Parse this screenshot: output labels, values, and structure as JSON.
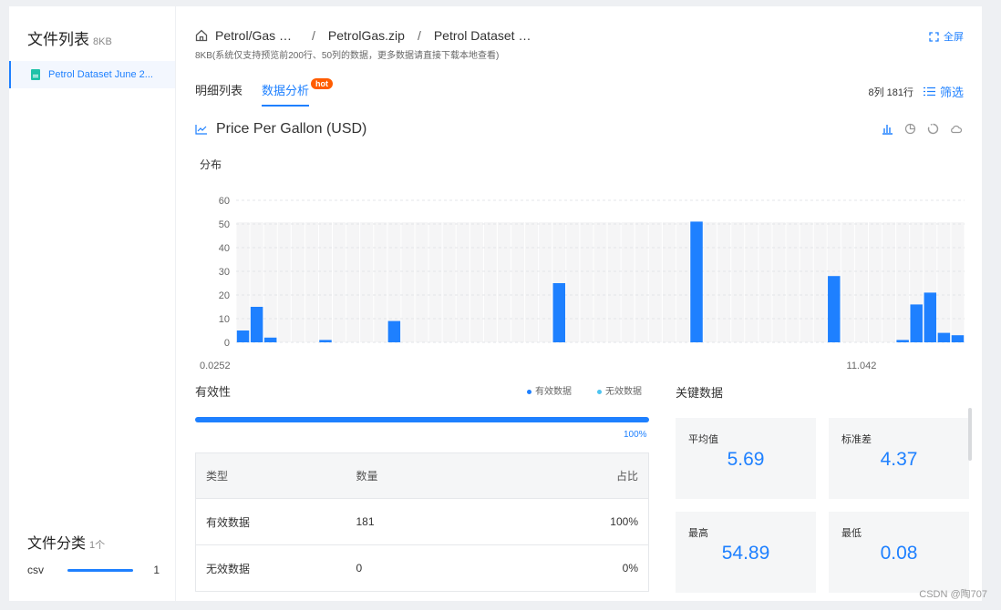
{
  "sidebar": {
    "title": "文件列表",
    "title_size": "8KB",
    "files": [
      {
        "name": "Petrol Dataset June 2..."
      }
    ],
    "category_title": "文件分类",
    "category_count": "1个",
    "categories": [
      {
        "label": "csv",
        "count": "1"
      }
    ]
  },
  "header": {
    "breadcrumb": [
      "Petrol/Gas 全球油价...",
      "PetrolGas.zip",
      "Petrol Dataset June 2..."
    ],
    "separator": "/",
    "note": "8KB(系统仅支持预览前200行、50列的数据，更多数据请直接下载本地查看)",
    "fullscreen_label": "全屏"
  },
  "tabs": [
    {
      "label": "明细列表",
      "active": false
    },
    {
      "label": "数据分析",
      "active": true,
      "badge": "hot"
    }
  ],
  "meta": {
    "dims": "8列 181行",
    "filter_label": "筛选"
  },
  "field": {
    "title": "Price Per Gallon (USD)",
    "distribution_label": "分布"
  },
  "chart_data": {
    "type": "bar",
    "bins": 50,
    "values": [
      5,
      15,
      2,
      0,
      0,
      0,
      1,
      0,
      0,
      0,
      0,
      9,
      0,
      0,
      0,
      0,
      0,
      0,
      0,
      0,
      0,
      0,
      0,
      25,
      0,
      0,
      0,
      0,
      0,
      0,
      0,
      0,
      0,
      51,
      0,
      0,
      0,
      0,
      0,
      0,
      0,
      0,
      0,
      28,
      0,
      0,
      0,
      0,
      1,
      16,
      21,
      4,
      3
    ],
    "ylim": [
      0,
      60
    ],
    "y_ticks": [
      0,
      10,
      20,
      30,
      40,
      50,
      60
    ],
    "x_labels": [
      {
        "text": "0.0252",
        "at_bin": 0
      },
      {
        "text": "11.042",
        "at_bin": 45
      }
    ],
    "bar_color": "#1e80ff",
    "grid": "horizontal dashed"
  },
  "validity": {
    "title": "有效性",
    "legend": [
      {
        "label": "有效数据",
        "color": "#1e80ff"
      },
      {
        "label": "无效数据",
        "color": "#4dc4f0"
      }
    ],
    "valid_fraction": 1.0,
    "percent_label": "100%",
    "headers": [
      "类型",
      "数量",
      "占比"
    ],
    "rows": [
      [
        "有效数据",
        "181",
        "100%"
      ],
      [
        "无效数据",
        "0",
        "0%"
      ]
    ]
  },
  "key_stats": {
    "title": "关键数据",
    "cards": [
      {
        "label": "平均值",
        "value": "5.69"
      },
      {
        "label": "标准差",
        "value": "4.37"
      },
      {
        "label": "最高",
        "value": "54.89"
      },
      {
        "label": "最低",
        "value": "0.08"
      }
    ]
  },
  "watermark": "CSDN @陶707"
}
